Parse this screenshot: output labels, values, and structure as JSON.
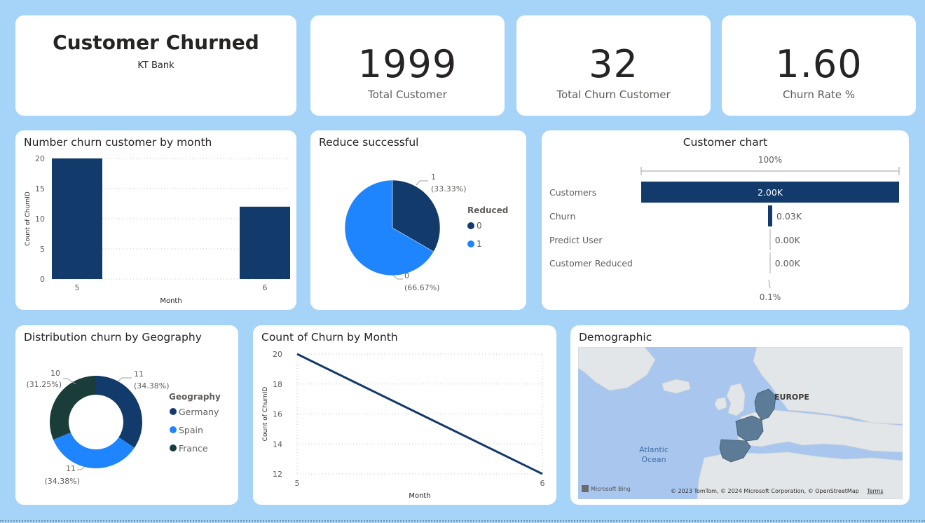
{
  "header": {
    "title": "Customer Churned",
    "subtitle": "KT Bank"
  },
  "kpis": [
    {
      "value": "1999",
      "label": "Total Customer"
    },
    {
      "value": "32",
      "label": "Total Churn Customer"
    },
    {
      "value": "1.60",
      "label": "Churn Rate  %"
    }
  ],
  "colors": {
    "navy": "#123a6b",
    "blue": "#1f85ff",
    "dark_green": "#1b3d39",
    "background": "#a6d3f8"
  },
  "bar_chart": {
    "title": "Number churn customer by month",
    "xlabel": "Month",
    "ylabel": "Count of ChurnID"
  },
  "pie_chart": {
    "title": "Reduce successful",
    "legend_title": "Reduced"
  },
  "funnel_chart": {
    "title": "Customer chart",
    "top_label": "100%",
    "bottom_label": "0.1%"
  },
  "donut_chart": {
    "title": "Distribution churn by Geography",
    "legend_title": "Geography"
  },
  "line_chart": {
    "title": "Count of Churn by Month",
    "xlabel": "Month",
    "ylabel": "Count of ChurnID"
  },
  "map": {
    "title": "Demographic",
    "region_label": "EUROPE",
    "ocean_label_1": "Atlantic",
    "ocean_label_2": "Ocean",
    "brand": "Microsoft Bing",
    "copyright": "© 2023 TomTom, © 2024 Microsoft Corporation, © OpenStreetMap",
    "terms": "Terms"
  },
  "chart_data": [
    {
      "type": "bar",
      "title": "Number churn customer by month",
      "xlabel": "Month",
      "ylabel": "Count of ChurnID",
      "categories": [
        "5",
        "6"
      ],
      "values": [
        20,
        12
      ],
      "ylim": [
        0,
        20
      ],
      "yticks": [
        0,
        5,
        10,
        15,
        20
      ],
      "grid": true
    },
    {
      "type": "pie",
      "title": "Reduce successful",
      "legend_title": "Reduced",
      "legend_position": "right",
      "slices": [
        {
          "name": "0",
          "value": 2,
          "percent_label": "(66.67%)",
          "color": "#1f85ff"
        },
        {
          "name": "1",
          "value": 1,
          "percent_label": "(33.33%)",
          "color": "#123a6b"
        }
      ],
      "legend": [
        {
          "name": "0",
          "color": "#123a6b"
        },
        {
          "name": "1",
          "color": "#1f85ff"
        }
      ]
    },
    {
      "type": "bar",
      "subtype": "funnel",
      "title": "Customer chart",
      "categories": [
        "Customers",
        "Churn",
        "Predict User",
        "Customer Reduced"
      ],
      "values": [
        2000,
        32,
        0,
        0
      ],
      "value_labels": [
        "2.00K",
        "0.03K",
        "0.00K",
        "0.00K"
      ],
      "top_percent": "100%",
      "bottom_percent": "0.1%"
    },
    {
      "type": "pie",
      "subtype": "donut",
      "title": "Distribution churn by Geography",
      "legend_title": "Geography",
      "legend_position": "right",
      "slices": [
        {
          "name": "Germany",
          "value": 11,
          "percent_label": "(34.38%)",
          "color": "#123a6b"
        },
        {
          "name": "Spain",
          "value": 11,
          "percent_label": "(34.38%)",
          "color": "#1f85ff"
        },
        {
          "name": "France",
          "value": 10,
          "percent_label": "(31.25%)",
          "color": "#1b3d39"
        }
      ]
    },
    {
      "type": "line",
      "title": "Count of Churn by Month",
      "xlabel": "Month",
      "ylabel": "Count of ChurnID",
      "x": [
        "5",
        "6"
      ],
      "values": [
        20,
        12
      ],
      "ylim": [
        12,
        20
      ],
      "yticks": [
        12,
        14,
        16,
        18,
        20
      ],
      "grid": true
    }
  ]
}
